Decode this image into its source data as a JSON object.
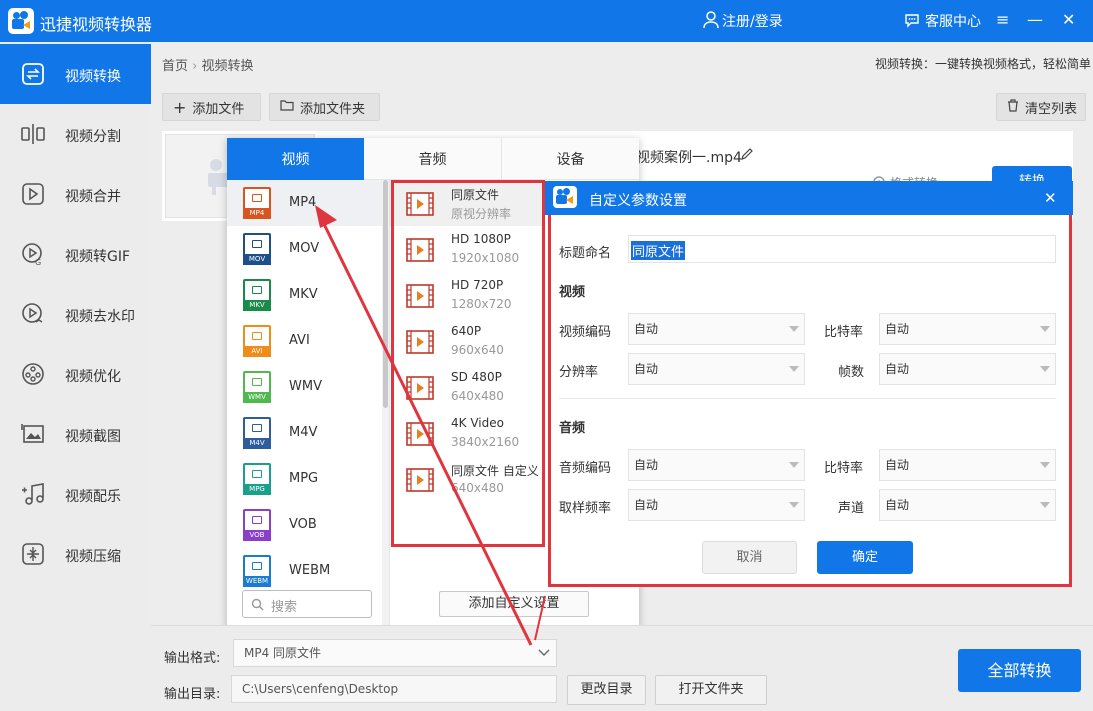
{
  "app": {
    "title": "迅捷视频转换器",
    "login": "注册/登录",
    "service": "客服中心",
    "minimize": "—",
    "close": "✕",
    "menu": "≡"
  },
  "sidebar": {
    "items": [
      {
        "label": "视频转换",
        "icon": "convert-icon"
      },
      {
        "label": "视频分割",
        "icon": "split-icon"
      },
      {
        "label": "视频合并",
        "icon": "merge-icon"
      },
      {
        "label": "视频转GIF",
        "icon": "gif-icon"
      },
      {
        "label": "视频去水印",
        "icon": "watermark-icon"
      },
      {
        "label": "视频优化",
        "icon": "optimize-icon"
      },
      {
        "label": "视频截图",
        "icon": "screenshot-icon"
      },
      {
        "label": "视频配乐",
        "icon": "music-icon"
      },
      {
        "label": "视频压缩",
        "icon": "compress-icon"
      }
    ]
  },
  "breadcrumb": {
    "home": "首页",
    "sep": "›",
    "current": "视频转换"
  },
  "description": "视频转换：一键转换视频格式，轻松简单",
  "toolbar": {
    "add_file": "添加文件",
    "add_folder": "添加文件夹",
    "clear_list": "清空列表"
  },
  "file": {
    "name": "视频案例一.mp4",
    "convert_label": "格式转换",
    "start_label": "转换"
  },
  "popup": {
    "tabs": [
      "视频",
      "音频",
      "设备"
    ],
    "formats": [
      {
        "label": "MP4",
        "color": "#d9541e"
      },
      {
        "label": "MOV",
        "color": "#1f4f8a"
      },
      {
        "label": "MKV",
        "color": "#1a8a4a"
      },
      {
        "label": "AVI",
        "color": "#f08c1a"
      },
      {
        "label": "WMV",
        "color": "#4fb84f"
      },
      {
        "label": "M4V",
        "color": "#2d5d9f"
      },
      {
        "label": "MPG",
        "color": "#1aa08a"
      },
      {
        "label": "VOB",
        "color": "#8a3fc8"
      },
      {
        "label": "WEBM",
        "color": "#1a7ad4"
      }
    ],
    "presets": [
      {
        "name": "同原文件",
        "sub": "原视分辨率"
      },
      {
        "name": "HD 1080P",
        "sub": "1920x1080"
      },
      {
        "name": "HD 720P",
        "sub": "1280x720"
      },
      {
        "name": "640P",
        "sub": "960x640"
      },
      {
        "name": "SD 480P",
        "sub": "640x480"
      },
      {
        "name": "4K Video",
        "sub": "3840x2160"
      },
      {
        "name": "同原文件 自定义",
        "sub": "640x480"
      }
    ],
    "search_placeholder": "搜索",
    "add_custom": "添加自定义设置"
  },
  "dialog": {
    "title": "自定义参数设置",
    "close": "✕",
    "title_label": "标题命名",
    "title_value": "同原文件",
    "video_section": "视频",
    "audio_section": "音频",
    "video_codec_label": "视频编码",
    "video_codec": "自动",
    "bitrate_label": "比特率",
    "bitrate": "自动",
    "resolution_label": "分辨率",
    "resolution": "自动",
    "fps_label": "帧数",
    "fps": "自动",
    "audio_codec_label": "音频编码",
    "audio_codec": "自动",
    "audio_bitrate_label": "比特率",
    "audio_bitrate": "自动",
    "sample_rate_label": "取样频率",
    "sample_rate": "自动",
    "channel_label": "声道",
    "channel": "自动",
    "cancel": "取消",
    "ok": "确定"
  },
  "bottom": {
    "output_format_label": "输出格式:",
    "output_format": "MP4  同原文件",
    "output_dir_label": "输出目录:",
    "output_dir": "C:\\Users\\cenfeng\\Desktop",
    "change_dir": "更改目录",
    "open_folder": "打开文件夹",
    "convert_all": "全部转换"
  },
  "colors": {
    "accent": "#1177e8",
    "highlight": "#e0343f"
  }
}
